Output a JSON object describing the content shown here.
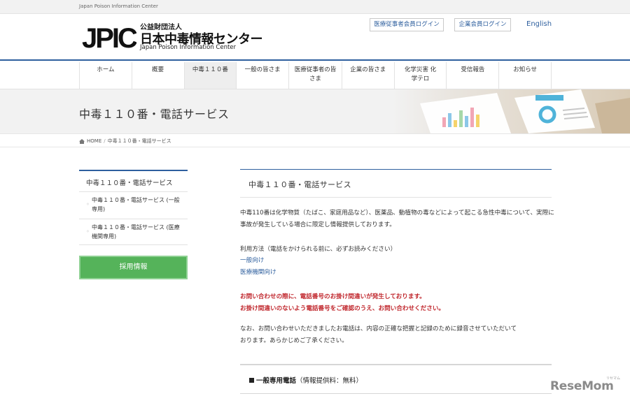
{
  "topbar": {
    "text": "Japan Poison Information Center"
  },
  "header": {
    "logo_org": "公益財団法人",
    "logo_name": "日本中毒情報センター",
    "logo_en": "Japan Poison Information Center",
    "logo_mark_letters": "JPIC",
    "medical_login": "医療従事者会員ログイン",
    "corporate_login": "企業会員ログイン",
    "english": "English",
    "accent_color": "#2e5f9e"
  },
  "nav": {
    "items": [
      {
        "label": "ホーム"
      },
      {
        "label": "概要"
      },
      {
        "label": "中毒１１０番"
      },
      {
        "label": "一般の皆さま"
      },
      {
        "label": "医療従事者の皆さま"
      },
      {
        "label": "企業の皆さま"
      },
      {
        "label": "化学災害 化学テロ"
      },
      {
        "label": "受信報告"
      },
      {
        "label": "お知らせ"
      }
    ],
    "active_index": 2
  },
  "banner": {
    "title": "中毒１１０番・電話サービス"
  },
  "breadcrumb": {
    "home": "HOME",
    "current": "中毒１１０番・電話サービス"
  },
  "sidebar": {
    "heading": "中毒１１０番・電話サービス",
    "items": [
      {
        "label": "中毒１１０番・電話サービス (一般専用)"
      },
      {
        "label": "中毒１１０番・電話サービス (医療機関専用)"
      }
    ],
    "button": "採用情報",
    "button_color": "#55b35a"
  },
  "main": {
    "heading": "中毒１１０番・電話サービス",
    "intro": "中毒110番は化学物質（たばこ、家庭用品など）、医薬品、動植物の毒などによって起こる急性中毒について、実際に事故が発生している場合に限定し情報提供しております。",
    "usage": "利用方法（電話をかけられる前に、必ずお読みください）",
    "link_general": "一般向け",
    "link_medical": "医療機関向け",
    "warning_1": "お問い合わせの際に、電話番号のお掛け間違いが発生しております。",
    "warning_2": "お掛け間違いのないよう電話番号をご確認のうえ、お問い合わせください。",
    "warning_color": "#c0272d",
    "note_1": "なお、お問い合わせいただきましたお電話は、内容の正確な把握と記録のために録音させていただいて",
    "note_2": "おります。あらかじめご了承ください。",
    "section_title": "一般専用電話",
    "section_sub": "（情報提供料：無料）"
  },
  "watermark": {
    "text": "ReseMom",
    "small": "リセマム"
  }
}
